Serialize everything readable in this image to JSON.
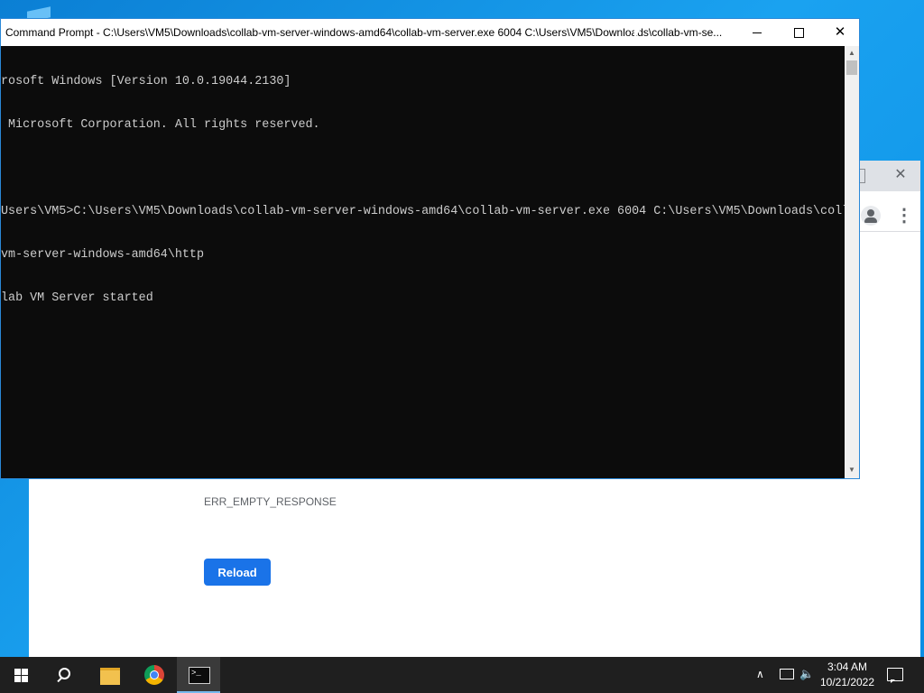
{
  "cmd": {
    "title": "Command Prompt - C:\\Users\\VM5\\Downloads\\collab-vm-server-windows-amd64\\collab-vm-server.exe  6004 C:\\Users\\VM5\\Downloads\\collab-vm-se...",
    "lines": [
      "rosoft Windows [Version 10.0.19044.2130]",
      " Microsoft Corporation. All rights reserved.",
      "",
      "Users\\VM5>C:\\Users\\VM5\\Downloads\\collab-vm-server-windows-amd64\\collab-vm-server.exe 6004 C:\\Users\\VM5\\Downloads\\coll",
      "vm-server-windows-amd64\\http",
      "lab VM Server started"
    ],
    "close_glyph": "✕"
  },
  "chrome": {
    "error_code": "ERR_EMPTY_RESPONSE",
    "reload_label": "Reload",
    "close_glyph": "✕",
    "menu_glyph": "⋮",
    "accent": "#1a73e8"
  },
  "taskbar": {
    "time": "3:04 AM",
    "date": "10/21/2022",
    "tray_chevron": "∧",
    "volume_glyph": "🔈"
  }
}
